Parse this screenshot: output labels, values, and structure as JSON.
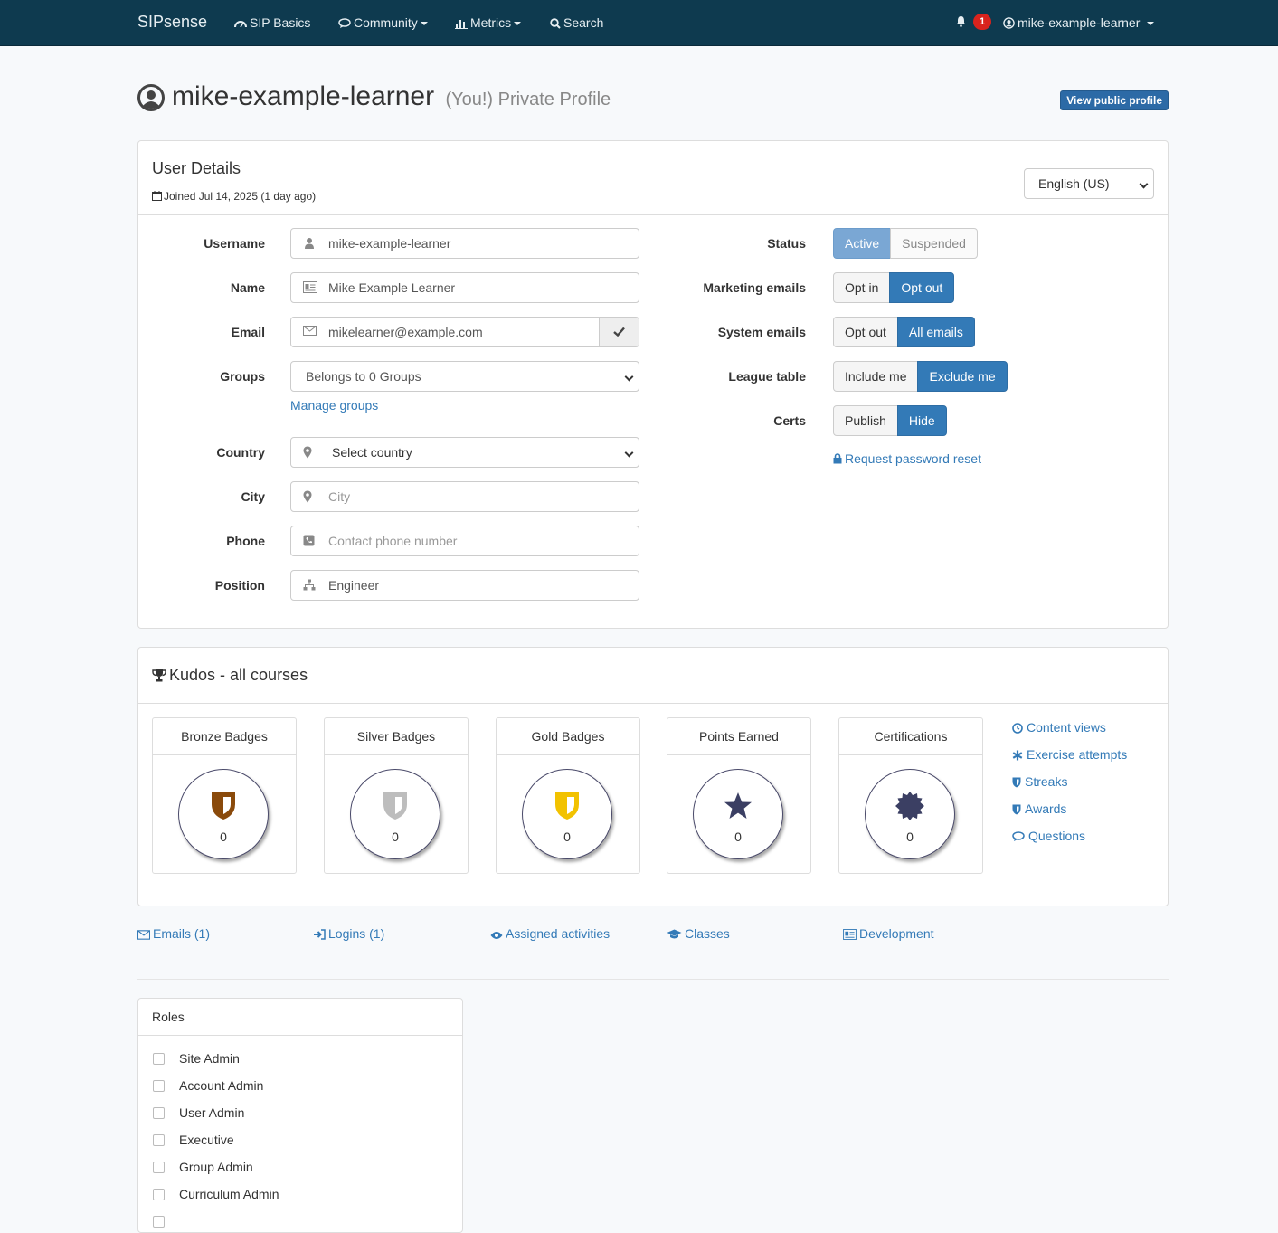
{
  "nav": {
    "brand": "SIPsense",
    "items": [
      "SIP Basics",
      "Community",
      "Metrics",
      "Search"
    ],
    "notifications": "1",
    "user": "mike-example-learner"
  },
  "header": {
    "username": "mike-example-learner",
    "you": "(You!)",
    "suffix": "Private Profile",
    "view_public": "View public profile"
  },
  "user_details": {
    "title": "User Details",
    "joined": "Joined Jul 14, 2025 (1 day ago)",
    "language": "English (US)",
    "fields": {
      "username": {
        "label": "Username",
        "value": "mike-example-learner"
      },
      "name": {
        "label": "Name",
        "value": "Mike Example Learner"
      },
      "email": {
        "label": "Email",
        "value": "mikelearner@example.com"
      },
      "groups": {
        "label": "Groups",
        "value": "Belongs to 0 Groups"
      },
      "manage_groups": "Manage groups",
      "country": {
        "label": "Country",
        "value": "Select country"
      },
      "city": {
        "label": "City",
        "placeholder": "City"
      },
      "phone": {
        "label": "Phone",
        "placeholder": "Contact phone number"
      },
      "position": {
        "label": "Position",
        "value": "Engineer"
      }
    },
    "settings": {
      "status": {
        "label": "Status",
        "a": "Active",
        "b": "Suspended"
      },
      "marketing": {
        "label": "Marketing emails",
        "a": "Opt in",
        "b": "Opt out"
      },
      "system": {
        "label": "System emails",
        "a": "Opt out",
        "b": "All emails"
      },
      "league": {
        "label": "League table",
        "a": "Include me",
        "b": "Exclude me"
      },
      "certs": {
        "label": "Certs",
        "a": "Publish",
        "b": "Hide"
      }
    },
    "reset": "Request password reset"
  },
  "kudos": {
    "title": "Kudos - all courses",
    "cards": [
      {
        "title": "Bronze Badges",
        "value": "0"
      },
      {
        "title": "Silver Badges",
        "value": "0"
      },
      {
        "title": "Gold Badges",
        "value": "0"
      },
      {
        "title": "Points Earned",
        "value": "0"
      },
      {
        "title": "Certifications",
        "value": "0"
      }
    ],
    "links": [
      "Content views",
      "Exercise attempts",
      "Streaks",
      "Awards",
      "Questions"
    ]
  },
  "sublinks": [
    "Emails (1)",
    "Logins (1)",
    "Assigned activities",
    "Classes",
    "Development"
  ],
  "roles": {
    "title": "Roles",
    "items": [
      "Site Admin",
      "Account Admin",
      "User Admin",
      "Executive",
      "Group Admin",
      "Curriculum Admin"
    ]
  },
  "colors": {
    "navbar": "#0e3a4f",
    "primary": "#337ab7",
    "bronze": "#8a4a0b",
    "silver": "#bdbdbd",
    "gold": "#f2c200",
    "icon_dark": "#3b3f63"
  }
}
